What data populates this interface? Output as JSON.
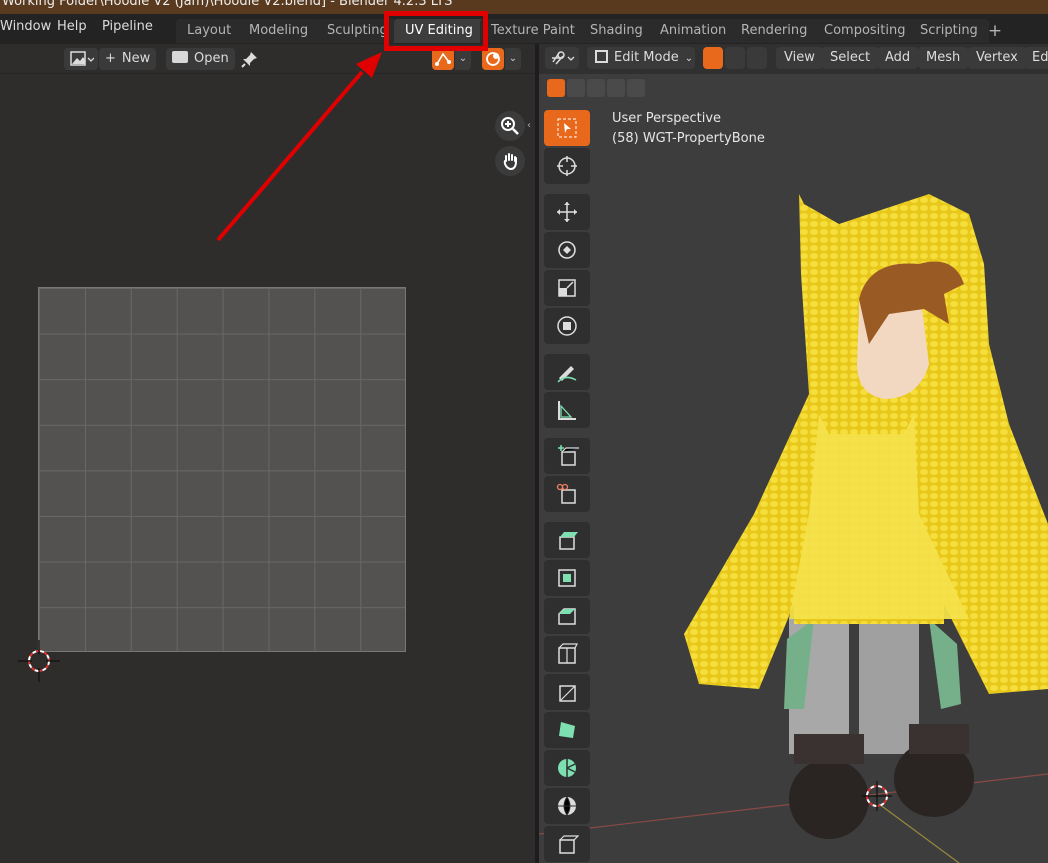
{
  "titlebar": {
    "text": "Working Folder\\Hoodie V2 (Jam)\\Hoodie V2.blend] - Blender 4.2.3 LTS"
  },
  "menu": {
    "window": "Window",
    "help": "Help",
    "pipeline": "Pipeline"
  },
  "workspaces": [
    "Layout",
    "Modeling",
    "Sculpting",
    "UV Editing",
    "Texture Paint",
    "Shading",
    "Animation",
    "Rendering",
    "Compositing",
    "Scripting"
  ],
  "active_workspace": "UV Editing",
  "uv_header": {
    "new_label": "New",
    "open_label": "Open"
  },
  "viewport": {
    "mode": "Edit Mode",
    "menus": [
      "View",
      "Select",
      "Add",
      "Mesh",
      "Vertex",
      "Ed"
    ],
    "perspective": "User Perspective",
    "object": "(58) WGT-PropertyBone"
  },
  "colors": {
    "accent": "#e8691b",
    "annotation": "#e00000",
    "hoodie": "#f0d020"
  }
}
